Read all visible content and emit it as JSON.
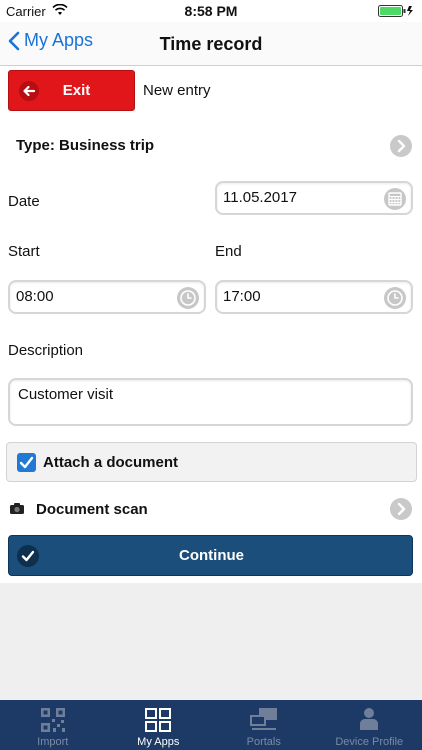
{
  "status_bar": {
    "carrier": "Carrier",
    "time": "8:58 PM"
  },
  "nav": {
    "back_label": "My Apps",
    "title": "Time record"
  },
  "exit": {
    "label": "Exit",
    "note": "New entry"
  },
  "type_row": {
    "label": "Type: Business trip"
  },
  "date": {
    "label": "Date",
    "value": "11.05.2017"
  },
  "start": {
    "label": "Start",
    "value": "08:00"
  },
  "end": {
    "label": "End",
    "value": "17:00"
  },
  "description": {
    "label": "Description",
    "value": "Customer visit"
  },
  "attach": {
    "label": "Attach a document",
    "checked": true
  },
  "scan": {
    "label": "Document scan"
  },
  "continue": {
    "label": "Continue"
  },
  "tabs": [
    {
      "label": "Import",
      "icon": "qr-code-icon",
      "active": false
    },
    {
      "label": "My Apps",
      "icon": "grid-icon",
      "active": true
    },
    {
      "label": "Portals",
      "icon": "portals-icon",
      "active": false
    },
    {
      "label": "Device Profile",
      "icon": "person-icon",
      "active": false
    }
  ],
  "colors": {
    "accent": "#1a73d9",
    "exit": "#e0161b",
    "continue": "#1b4e7a",
    "tabbar": "#1d3a66",
    "battery": "#4cd964"
  }
}
